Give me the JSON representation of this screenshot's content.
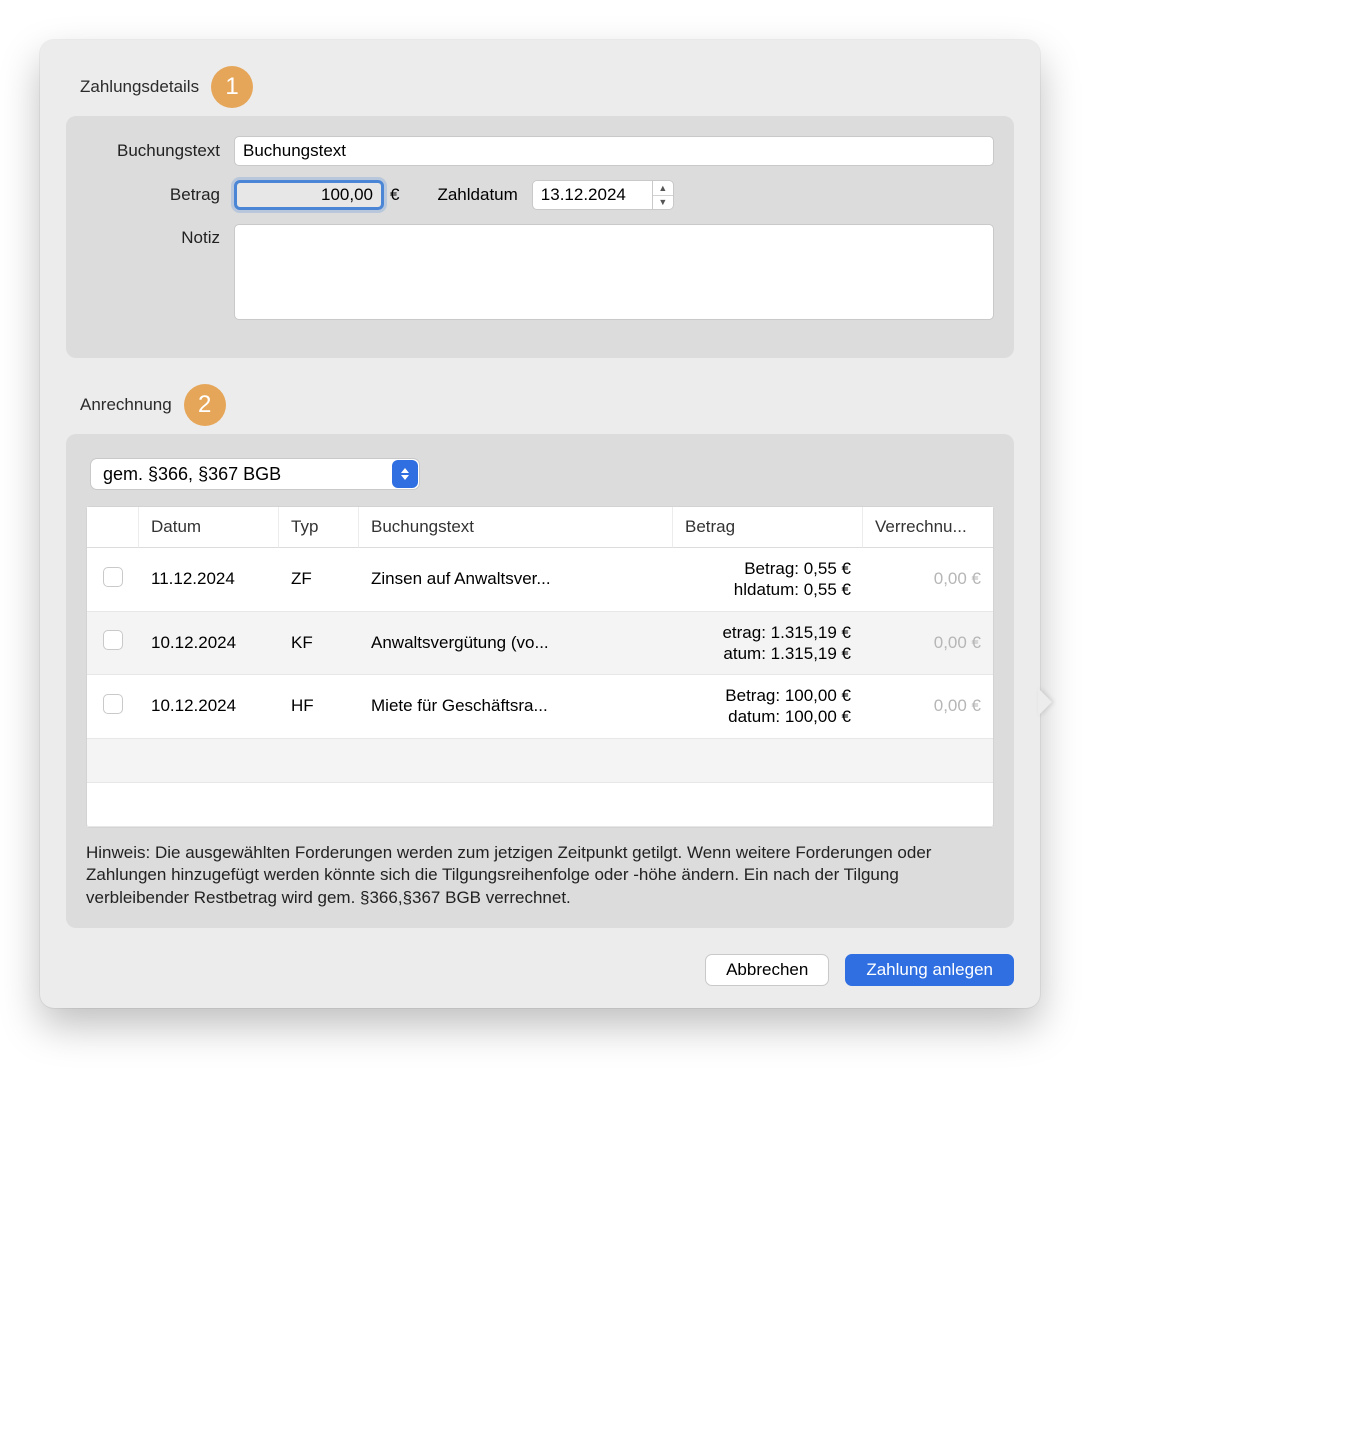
{
  "sections": {
    "details": {
      "title": "Zahlungsdetails",
      "badge": "1"
    },
    "anrechnung": {
      "title": "Anrechnung",
      "badge": "2"
    }
  },
  "form": {
    "buchungstext_label": "Buchungstext",
    "buchungstext_value": "Buchungstext",
    "betrag_label": "Betrag",
    "betrag_value": "100,00",
    "currency": "€",
    "zahldatum_label": "Zahldatum",
    "zahldatum_value": "13.12.2024",
    "notiz_label": "Notiz",
    "notiz_value": ""
  },
  "anrechnung": {
    "select_value": "gem. §366, §367 BGB",
    "columns": {
      "datum": "Datum",
      "typ": "Typ",
      "text": "Buchungstext",
      "betrag": "Betrag",
      "verr": "Verrechnu..."
    },
    "rows": [
      {
        "datum": "11.12.2024",
        "typ": "ZF",
        "text": "Zinsen auf Anwaltsver...",
        "betrag_l1": "Betrag: 0,55 €",
        "betrag_l2": "hldatum: 0,55 €",
        "verr": "0,00 €"
      },
      {
        "datum": "10.12.2024",
        "typ": "KF",
        "text": "Anwaltsvergütung (vo...",
        "betrag_l1": "etrag: 1.315,19 €",
        "betrag_l2": "atum: 1.315,19 €",
        "verr": "0,00 €"
      },
      {
        "datum": "10.12.2024",
        "typ": "HF",
        "text": "Miete für Geschäftsra...",
        "betrag_l1": "Betrag: 100,00 €",
        "betrag_l2": "datum: 100,00 €",
        "verr": "0,00 €"
      }
    ],
    "hint": "Hinweis: Die ausgewählten Forderungen werden zum jetzigen Zeitpunkt getilgt. Wenn weitere Forderungen oder Zahlungen hinzugefügt werden könnte sich die Tilgungsreihenfolge oder -höhe ändern. Ein nach der Tilgung verbleibender Restbetrag wird gem. §366,§367 BGB verrechnet."
  },
  "buttons": {
    "cancel": "Abbrechen",
    "submit": "Zahlung anlegen"
  }
}
